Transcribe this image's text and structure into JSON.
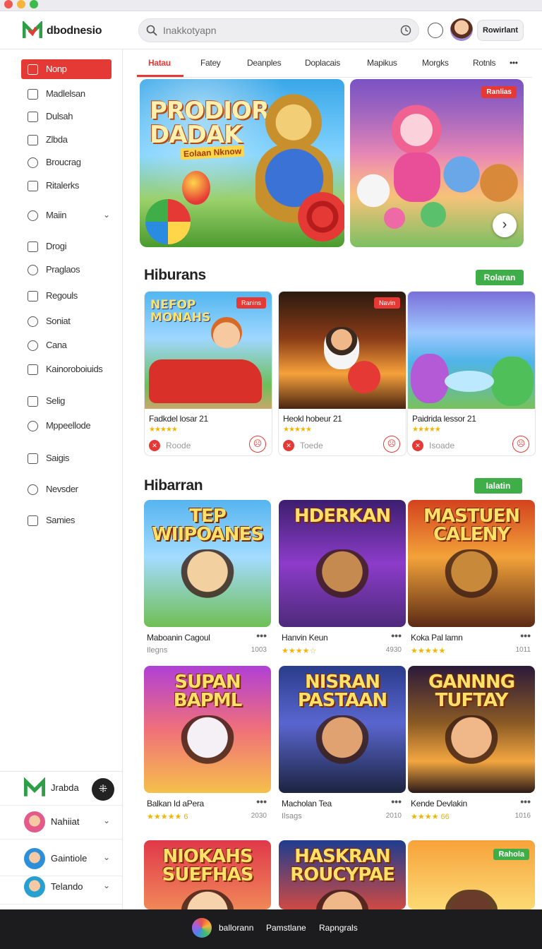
{
  "app": {
    "brand": "dbodnesio",
    "profile_button": "Rowirlant"
  },
  "search": {
    "placeholder": "Inakkotyapn"
  },
  "sidebar": {
    "items": [
      {
        "label": "Nonp",
        "icon": "home-icon",
        "active": true
      },
      {
        "label": "Madlelsan",
        "icon": "edit-icon"
      },
      {
        "label": "Dulsah",
        "icon": "share-icon"
      },
      {
        "label": "Zlbda",
        "icon": "chart-icon"
      },
      {
        "label": "Broucrag",
        "icon": "clock-icon"
      },
      {
        "label": "Ritalerks",
        "icon": "info-icon"
      },
      {
        "label": "Maiin",
        "icon": "search-icon",
        "expandable": true
      },
      {
        "label": "Drogi",
        "icon": "edit-icon"
      },
      {
        "label": "Praglaos",
        "icon": "clock-icon"
      },
      {
        "label": "Regouls",
        "icon": "info-icon"
      },
      {
        "label": "Soniat",
        "icon": "target-icon"
      },
      {
        "label": "Cana",
        "icon": "check-icon"
      },
      {
        "label": "Kainoroboiuids",
        "icon": "play-icon"
      },
      {
        "label": "Selig",
        "icon": "edit-icon"
      },
      {
        "label": "Mppeellode",
        "icon": "clock-icon"
      },
      {
        "label": "Saigis",
        "icon": "mail-icon"
      },
      {
        "label": "Nevsder",
        "icon": "search-icon"
      },
      {
        "label": "Samies",
        "icon": "info-icon"
      }
    ],
    "bottom": [
      {
        "name": "Jrabda"
      },
      {
        "name": "Nahiiat"
      },
      {
        "name": "Gaintiole"
      },
      {
        "name": "Telando"
      }
    ]
  },
  "tabs": [
    "Hatau",
    "Fatey",
    "Deanples",
    "Doplacais",
    "Mapikus",
    "Morgks",
    "Rotnls",
    "•••"
  ],
  "hero": {
    "left_title_1": "PRODIOR",
    "left_title_2": "DADAK",
    "left_subtitle": "Eolaan Nknow",
    "right_badge": "Ranlias"
  },
  "section1": {
    "title": "Hiburans",
    "action": "Rolaran",
    "cards": [
      {
        "art": "NEFOP MONAHS",
        "badge": "Ranins",
        "title": "Fadkdel losar 21",
        "stars": "★★★★★",
        "foot": "Roode"
      },
      {
        "art": "",
        "badge": "Navin",
        "title": "Heokl hobeur 21",
        "stars": "★★★★★",
        "foot": "Toede"
      },
      {
        "art": "",
        "badge": "",
        "title": "Paidrida lessor 21",
        "stars": "★★★★★",
        "foot": "Isoade"
      }
    ]
  },
  "section2": {
    "title": "Hibarran",
    "action": "Ialatin",
    "tiles": [
      {
        "art": "TEP WIIPOANES",
        "title": "Maboanin Cagoul",
        "sub": "Ilegns",
        "num": "1003"
      },
      {
        "art": "HDERKAN",
        "title": "Hanvin Keun",
        "sub": "★★★★☆",
        "num": "4930"
      },
      {
        "art": "MASTUEN CALENY",
        "title": "Koka Pal lamn",
        "sub": "★★★★★",
        "num": "1011"
      },
      {
        "art": "SUPAN BAPML",
        "title": "Balkan Id aPera",
        "sub": "★★★★★ 6",
        "num": "2030"
      },
      {
        "art": "NISRAN PASTAAN",
        "title": "Macholan Tea",
        "sub": "Ilsags",
        "num": "2010"
      },
      {
        "art": "GANNNG TUFTAY",
        "title": "Kende Devlakin",
        "sub": "★★★★ 66",
        "num": "1016"
      },
      {
        "art": "NIOKAHS SUEFHAS",
        "title": "",
        "sub": "",
        "num": ""
      },
      {
        "art": "HASKRAN ROUCYPAE",
        "title": "",
        "sub": "",
        "num": ""
      },
      {
        "art": "",
        "badge": "Rahola",
        "title": "",
        "sub": "",
        "num": ""
      }
    ]
  },
  "footer": {
    "links": [
      "ballorann",
      "Pamstlane",
      "Rapngrals"
    ]
  },
  "colors": {
    "accent": "#e53935",
    "green": "#3fae49",
    "dark": "#1c1c1e"
  }
}
